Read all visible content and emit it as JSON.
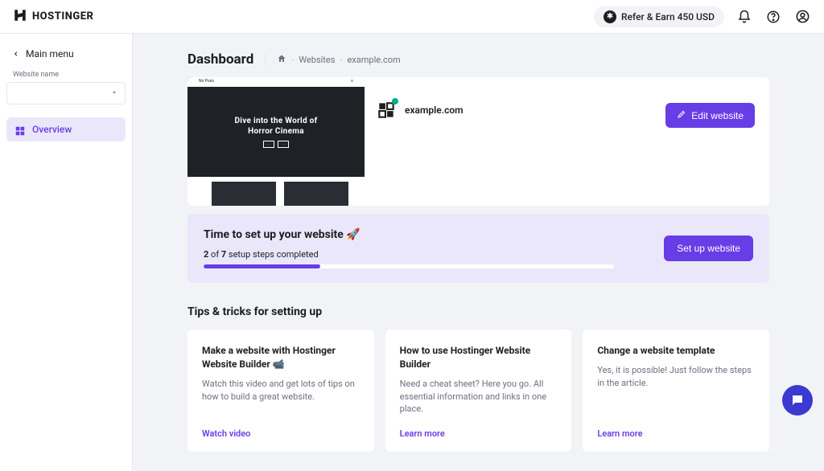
{
  "header": {
    "brand": "HOSTINGER",
    "refer_label": "Refer & Earn 450 USD"
  },
  "sidebar": {
    "back_label": "Main menu",
    "website_dropdown_label": "Website name",
    "nav": {
      "overview": "Overview"
    }
  },
  "page": {
    "title": "Dashboard",
    "breadcrumb": {
      "item1": "Websites",
      "item2": "example.com"
    }
  },
  "site": {
    "name": "example.com",
    "edit_label": "Edit website",
    "preview": {
      "line1": "Dive into the World of",
      "line2": "Horror Cinema",
      "brand": "No Puns"
    }
  },
  "setup": {
    "title": "Time to set up your website 🚀",
    "done": "2",
    "total": "7",
    "of": " of ",
    "suffix": " setup steps completed",
    "button": "Set up website"
  },
  "tips": {
    "heading": "Tips & tricks for setting up",
    "cards": [
      {
        "title": "Make a website with Hostinger Website Builder 📹",
        "desc": "Watch this video and get lots of tips on how to build a great website.",
        "link": "Watch video"
      },
      {
        "title": "How to use Hostinger Website Builder",
        "desc": "Need a cheat sheet? Here you go. All essential information and links in one place.",
        "link": "Learn more"
      },
      {
        "title": "Change a website template",
        "desc": "Yes, it is possible! Just follow the steps in the article.",
        "link": "Learn more"
      }
    ]
  }
}
